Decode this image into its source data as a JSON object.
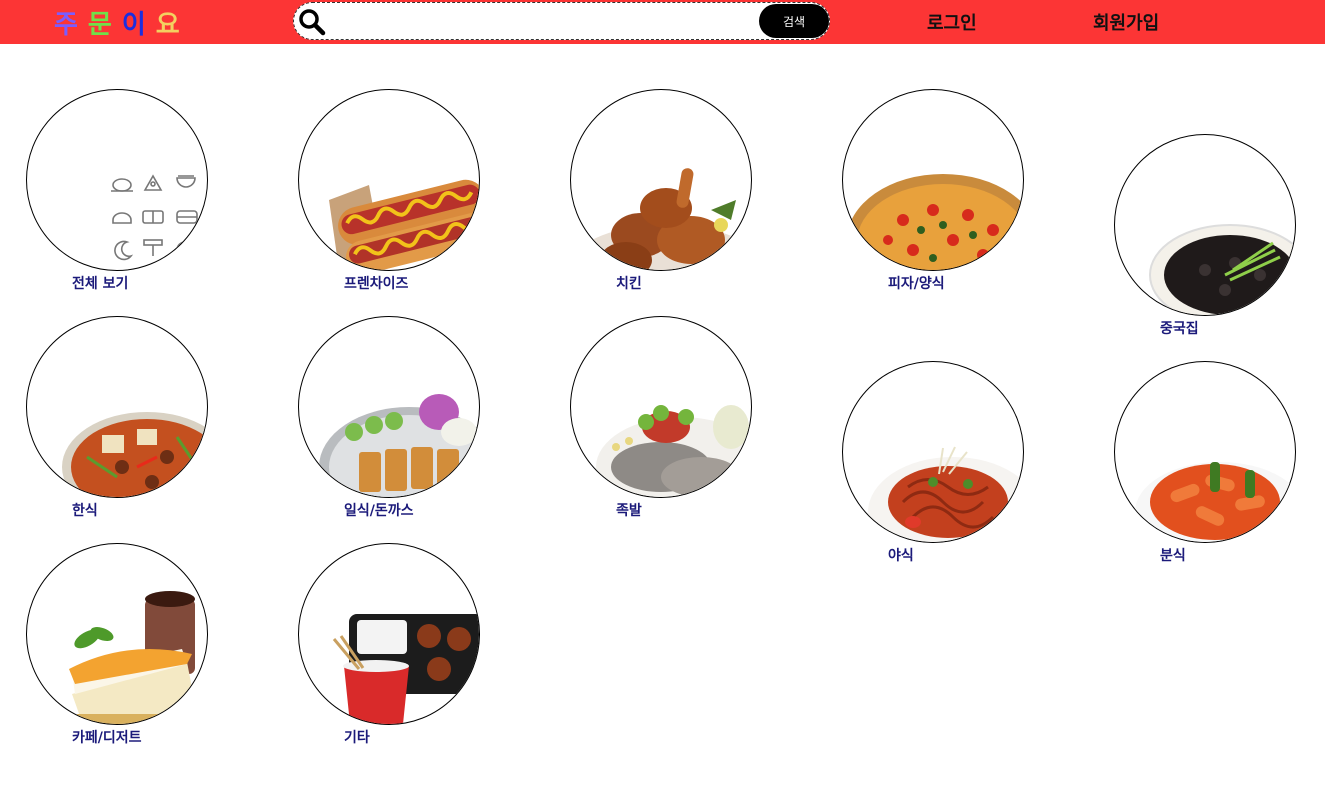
{
  "header": {
    "logo_chars": [
      "주",
      "문",
      "이",
      "요"
    ],
    "logo_colors": [
      "#7a5cff",
      "#6fe04a",
      "#1a2ee0",
      "#f3d060"
    ],
    "search": {
      "placeholder": "",
      "value": "",
      "button_label": "검색"
    },
    "login_label": "로그인",
    "signup_label": "회원가입"
  },
  "categories": [
    {
      "label": "전체 보기",
      "icon": "all-categories-icon"
    },
    {
      "label": "프렌차이즈",
      "icon": "hotdog-icon"
    },
    {
      "label": "치킨",
      "icon": "chicken-icon"
    },
    {
      "label": "피자/양식",
      "icon": "pizza-icon"
    },
    {
      "label": "중국집",
      "icon": "jajangmyeon-icon"
    },
    {
      "label": "한식",
      "icon": "stew-icon"
    },
    {
      "label": "일식/돈까스",
      "icon": "tonkatsu-icon"
    },
    {
      "label": "족발",
      "icon": "jokbal-icon"
    },
    {
      "label": "야식",
      "icon": "late-night-food-icon"
    },
    {
      "label": "분식",
      "icon": "tteokbokki-icon"
    },
    {
      "label": "카페/디저트",
      "icon": "cake-icon"
    },
    {
      "label": "기타",
      "icon": "lunchbox-icon"
    }
  ],
  "colors": {
    "header_bg": "#fc3535",
    "label": "#1b1a7a",
    "search_button": "#000000"
  }
}
